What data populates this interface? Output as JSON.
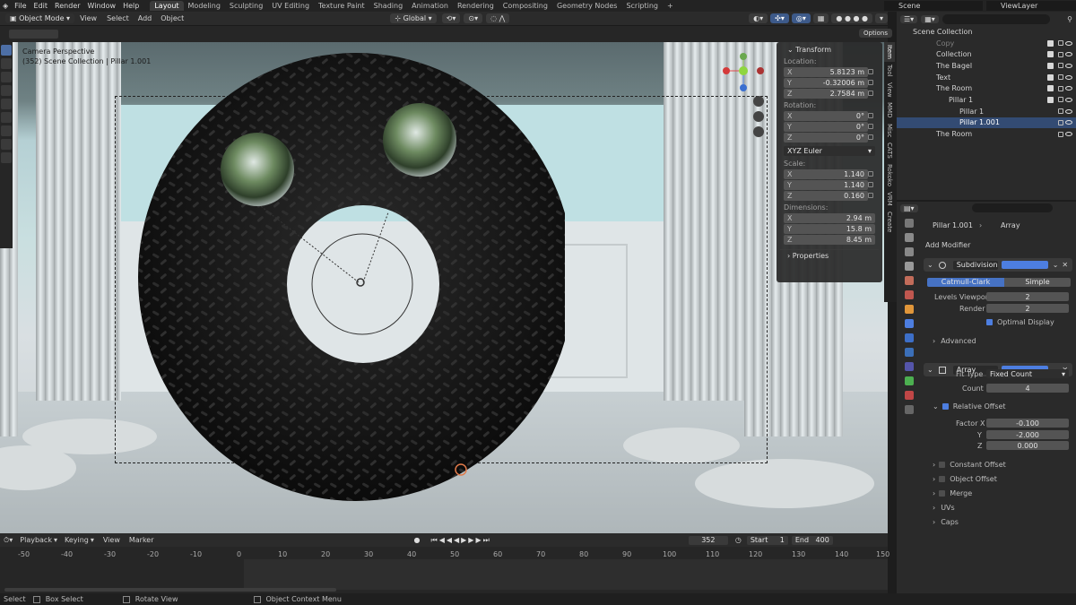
{
  "menu": [
    "File",
    "Edit",
    "Render",
    "Window",
    "Help"
  ],
  "workspaces": [
    {
      "label": "Layout",
      "active": true
    },
    {
      "label": "Modeling"
    },
    {
      "label": "Sculpting"
    },
    {
      "label": "UV Editing"
    },
    {
      "label": "Texture Paint"
    },
    {
      "label": "Shading"
    },
    {
      "label": "Animation"
    },
    {
      "label": "Rendering"
    },
    {
      "label": "Compositing"
    },
    {
      "label": "Geometry Nodes"
    },
    {
      "label": "Scripting"
    },
    {
      "label": "+"
    }
  ],
  "scene": {
    "name": "Scene",
    "view_layer": "ViewLayer"
  },
  "header": {
    "mode": "Object Mode",
    "menus": [
      "View",
      "Select",
      "Add",
      "Object"
    ],
    "orientation": "Global",
    "options": "Options"
  },
  "viewport": {
    "camera": "Camera Perspective",
    "collection": "(352) Scene Collection | Pillar 1.001"
  },
  "npanel": {
    "title": "Transform",
    "location_label": "Location:",
    "location": [
      {
        "axis": "X",
        "value": "5.8123 m"
      },
      {
        "axis": "Y",
        "value": "-0.32006 m"
      },
      {
        "axis": "Z",
        "value": "2.7584 m"
      }
    ],
    "rotation_label": "Rotation:",
    "rotation": [
      {
        "axis": "X",
        "value": "0°"
      },
      {
        "axis": "Y",
        "value": "0°"
      },
      {
        "axis": "Z",
        "value": "0°"
      }
    ],
    "rotation_mode": "XYZ Euler",
    "scale_label": "Scale:",
    "scale": [
      {
        "axis": "X",
        "value": "1.140"
      },
      {
        "axis": "Y",
        "value": "1.140"
      },
      {
        "axis": "Z",
        "value": "0.160"
      }
    ],
    "dimensions_label": "Dimensions:",
    "dimensions": [
      {
        "axis": "X",
        "value": "2.94 m"
      },
      {
        "axis": "Y",
        "value": "15.8 m"
      },
      {
        "axis": "Z",
        "value": "8.45 m"
      }
    ],
    "properties": "Properties"
  },
  "vtabs": [
    "Item",
    "Tool",
    "View",
    "MMD",
    "Misc",
    "CATS",
    "Rokoko",
    "VRM",
    "Create"
  ],
  "outliner": {
    "root": "Scene Collection",
    "rows": [
      {
        "label": "Copy",
        "indent": 1,
        "dim": true
      },
      {
        "label": "Collection",
        "indent": 1
      },
      {
        "label": "The Bagel",
        "indent": 1
      },
      {
        "label": "Text",
        "indent": 1
      },
      {
        "label": "The Room",
        "indent": 1
      },
      {
        "label": "Pillar 1",
        "indent": 2
      },
      {
        "label": "Pillar 1",
        "indent": 3
      },
      {
        "label": "Pillar 1.001",
        "indent": 3,
        "selected": true
      },
      {
        "label": "The Room",
        "indent": 2
      }
    ]
  },
  "props": {
    "breadcrumb_obj": "Pillar 1.001",
    "breadcrumb_mod": "Array",
    "add_modifier": "Add Modifier",
    "subdiv": {
      "name": "Subdivision",
      "tab1": "Catmull-Clark",
      "tab2": "Simple",
      "levels_label": "Levels Viewport",
      "levels": "2",
      "render_label": "Render",
      "render": "2",
      "optimal": "Optimal Display",
      "advanced": "Advanced"
    },
    "array": {
      "name": "Array",
      "fit_label": "Fit Type",
      "fit": "Fixed Count",
      "count_label": "Count",
      "count": "4",
      "rel": "Relative Offset",
      "factor_label": "Factor X",
      "fx": "-0.100",
      "y_label": "Y",
      "fy": "-2.000",
      "z_label": "Z",
      "fz": "0.000",
      "subs": [
        "Constant Offset",
        "Object Offset",
        "Merge",
        "UVs",
        "Caps"
      ]
    }
  },
  "timeline": {
    "menus": [
      "Playback",
      "Keying",
      "View",
      "Marker"
    ],
    "current": "352",
    "start_label": "Start",
    "start": "1",
    "end_label": "End",
    "end": "400",
    "ticks": [
      "-50",
      "-40",
      "-30",
      "-20",
      "-10",
      "0",
      "10",
      "20",
      "30",
      "40",
      "50",
      "60",
      "70",
      "80",
      "90",
      "100",
      "110",
      "120",
      "130",
      "140",
      "150"
    ]
  },
  "status": [
    "Select",
    "Box Select",
    "Rotate View",
    "Object Context Menu"
  ]
}
